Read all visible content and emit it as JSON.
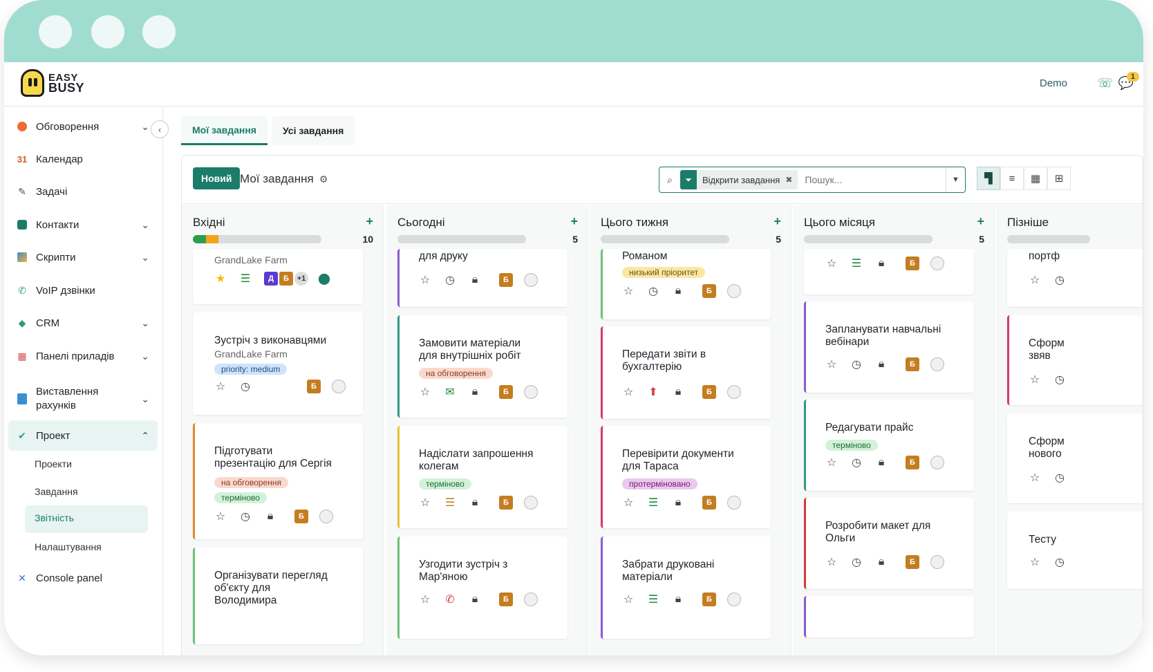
{
  "app": {
    "brand": {
      "line1": "EASY",
      "line2": "BUSY"
    },
    "user": "Demo",
    "notification_count": "1"
  },
  "sidebar": {
    "items": [
      {
        "label": "Обговорення",
        "icon": "chat-bubble-icon",
        "color": "#ef6c35"
      },
      {
        "label": "Календар",
        "icon": "calendar-icon",
        "glyph": "31",
        "color": "#d55a2a"
      },
      {
        "label": "Задачі",
        "icon": "pencil-icon",
        "color": "#3a5a6a"
      },
      {
        "label": "Контакти",
        "icon": "contact-card-icon",
        "color": "#1b7d69"
      },
      {
        "label": "Скрипти",
        "icon": "script-icon",
        "color": "#3b8fd1"
      },
      {
        "label": "VoIP дзвінки",
        "icon": "phone-icon",
        "color": "#2f9a84"
      },
      {
        "label": "CRM",
        "icon": "crm-icon",
        "color": "#2f9a84"
      },
      {
        "label": "Панелі приладів",
        "icon": "dashboard-icon",
        "color": "#d44f4f"
      },
      {
        "label_line1": "Виставлення",
        "label_line2": "рахунків",
        "icon": "invoice-icon",
        "color": "#3b8fd1"
      },
      {
        "label": "Проект",
        "icon": "check-icon",
        "color": "#2f9a84"
      },
      {
        "label": "Console panel",
        "icon": "tools-icon",
        "color": "#3b6fd1"
      }
    ],
    "subitems": [
      "Проекти",
      "Завдання",
      "Звітність",
      "Налаштування"
    ]
  },
  "tabs": [
    "Мої завдання",
    "Усі завдання"
  ],
  "control_panel": {
    "new_button": "Новий",
    "title": "Мої завдання",
    "filter_facet": "Відкрити завдання",
    "search_placeholder": "Пошук..."
  },
  "columns": [
    {
      "title": "Вхідні",
      "count": "10",
      "progress": [
        0.1,
        0.1
      ],
      "cards": [
        {
          "subtitle": "GrandLake Farm",
          "avatars": [
            "Д",
            "Б"
          ],
          "more": "+1"
        },
        {
          "title": "Зустріч з виконавцями",
          "subtitle": "GrandLake Farm",
          "tag": "priority: medium",
          "avatar": "Б"
        },
        {
          "title1": "Підготувати",
          "title2": "презентацію для Сергія",
          "tags": [
            "на обговорення",
            "терміново"
          ],
          "avatar": "Б"
        },
        {
          "title1": "Організувати перегляд",
          "title2": "об'єкту для",
          "title3": "Володимира"
        }
      ]
    },
    {
      "title": "Сьогодні",
      "count": "5",
      "cards": [
        {
          "title": "для друку",
          "avatar": "Б"
        },
        {
          "title1": "Замовити матеріали",
          "title2": "для внутрішніх робіт",
          "tag": "на обговорення",
          "avatar": "Б"
        },
        {
          "title1": "Надіслати запрошення",
          "title2": "колегам",
          "tag": "терміново",
          "avatar": "Б"
        },
        {
          "title1": "Узгодити зустріч з",
          "title2": "Мар'яною",
          "avatar": "Б"
        }
      ]
    },
    {
      "title": "Цього тижня",
      "count": "5",
      "cards": [
        {
          "title": "Романом",
          "tag": "низький пріоритет",
          "avatar": "Б"
        },
        {
          "title1": "Передати звіти в",
          "title2": "бухгалтерію",
          "avatar": "Б"
        },
        {
          "title1": "Перевірити документи",
          "title2": "для Тараса",
          "tag": "протерміновано",
          "avatar": "Б"
        },
        {
          "title1": "Забрати друковані",
          "title2": "матеріали",
          "avatar": "Б"
        }
      ]
    },
    {
      "title": "Цього місяця",
      "count": "5",
      "cards": [
        {
          "avatar": "Б"
        },
        {
          "title1": "Запланувати навчальні",
          "title2": "вебінари",
          "avatar": "Б"
        },
        {
          "title": "Редагувати прайс",
          "tag": "терміново",
          "avatar": "Б"
        },
        {
          "title1": "Розробити макет для",
          "title2": "Ольги",
          "avatar": "Б"
        }
      ]
    },
    {
      "title": "Пізніше",
      "cards": [
        {
          "title": "портф"
        },
        {
          "title1": "Сформ",
          "title2": "звяв"
        },
        {
          "title1": "Сформ",
          "title2": "нового"
        },
        {
          "title": "Тесту"
        }
      ]
    }
  ],
  "colors": {
    "accent": "#1b7d69",
    "tag_priority_bg": "#cfe3fb",
    "tag_discuss_bg": "#f9d9cf",
    "tag_urgent_bg": "#d2f2d9",
    "tag_low_bg": "#fbe7a4",
    "tag_overdue_bg": "#ecc7ee",
    "progress_green": "#2e9e4e",
    "progress_orange": "#f0a51b"
  }
}
